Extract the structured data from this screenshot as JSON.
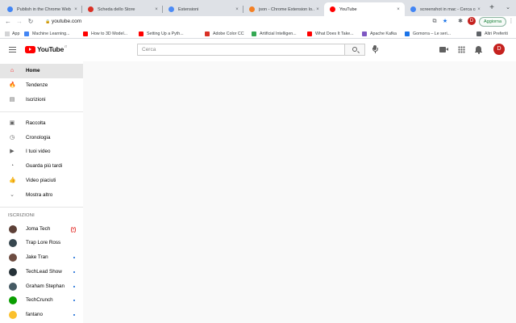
{
  "browser": {
    "tabs": [
      {
        "title": "Publish in the Chrome Web",
        "favicon_color": "#4285f4",
        "active": false
      },
      {
        "title": "Scheda dello Store",
        "favicon_color": "#d93025",
        "active": false
      },
      {
        "title": "Estensioni",
        "favicon_color": "#4c8bf5",
        "active": false
      },
      {
        "title": "json - Chrome Extension lo...",
        "favicon_color": "#f48024",
        "active": false
      },
      {
        "title": "YouTube",
        "favicon_color": "#ff0000",
        "active": true
      },
      {
        "title": "screenshot in mac - Cerca co",
        "favicon_color": "#4285f4",
        "active": false
      }
    ],
    "close_glyph": "×",
    "new_tab_glyph": "+",
    "tab_search_glyph": "⌄",
    "toolbar": {
      "back_glyph": "←",
      "forward_glyph": "→",
      "reload_glyph": "↻",
      "lock_glyph": "🔒",
      "url": "youtube.com",
      "update_label": "Aggiorna",
      "profile_initial": "D",
      "menu_glyph": "⋮",
      "star_glyph": "★",
      "extensions_glyph": "✱",
      "cast_glyph": "⧉"
    },
    "bookmarks": [
      {
        "label": "App",
        "favicon_color": "",
        "is_apps": true
      },
      {
        "label": "Machine Learning...",
        "favicon_color": "#4285f4"
      },
      {
        "label": "How to 3D Model...",
        "favicon_color": "#ff0000"
      },
      {
        "label": "Setting Up a Pyth...",
        "favicon_color": "#ff0000"
      },
      {
        "label": "Adobe Color CC",
        "favicon_color": "#d93025"
      },
      {
        "label": "Artificial Intelligen...",
        "favicon_color": "#34a853"
      },
      {
        "label": "What Does It Take...",
        "favicon_color": "#ff0000"
      },
      {
        "label": "Apache Kafka",
        "favicon_color": "#7e57c2"
      },
      {
        "label": "Gomorra – Le seri...",
        "favicon_color": "#1a73e8"
      }
    ],
    "other_bookmarks": {
      "label": "Altri Preferiti",
      "folder_color": "#5f6368"
    }
  },
  "youtube": {
    "logo_text": "YouTube",
    "country_code": "IT",
    "search_placeholder": "Cerca",
    "profile_initial": "D",
    "nav_items": [
      {
        "label": "Home",
        "icon": "home-icon",
        "glyph": "⌂",
        "active": true,
        "color": "#ff0000"
      },
      {
        "label": "Tendenze",
        "icon": "trending-icon",
        "glyph": "🔥",
        "active": false,
        "color": "#606060"
      },
      {
        "label": "Iscrizioni",
        "icon": "subscriptions-icon",
        "glyph": "▤",
        "active": false,
        "color": "#606060"
      }
    ],
    "library_items": [
      {
        "label": "Raccolta",
        "icon": "library-icon",
        "glyph": "▣"
      },
      {
        "label": "Cronologia",
        "icon": "history-icon",
        "glyph": "◷"
      },
      {
        "label": "I tuoi video",
        "icon": "your-videos-icon",
        "glyph": "▶"
      },
      {
        "label": "Guarda più tardi",
        "icon": "watch-later-icon",
        "glyph": "◔"
      },
      {
        "label": "Video piaciuti",
        "icon": "liked-videos-icon",
        "glyph": "👍"
      },
      {
        "label": "Mostra altro",
        "icon": "chevron-down-icon",
        "glyph": "⌄"
      }
    ],
    "subscriptions_heading": "ISCRIZIONI",
    "subscriptions": [
      {
        "name": "Joma Tech",
        "avatar_color": "#5d4037",
        "indicator": "live"
      },
      {
        "name": "Trap Lore Ross",
        "avatar_color": "#37474f",
        "indicator": "none"
      },
      {
        "name": "Jake Tran",
        "avatar_color": "#6d4c41",
        "indicator": "new"
      },
      {
        "name": "TechLead Show",
        "avatar_color": "#263238",
        "indicator": "new"
      },
      {
        "name": "Graham Stephan",
        "avatar_color": "#455a64",
        "indicator": "new"
      },
      {
        "name": "TechCrunch",
        "avatar_color": "#0a9e01",
        "indicator": "new"
      },
      {
        "name": "fantano",
        "avatar_color": "#fbc02d",
        "indicator": "new"
      }
    ]
  }
}
